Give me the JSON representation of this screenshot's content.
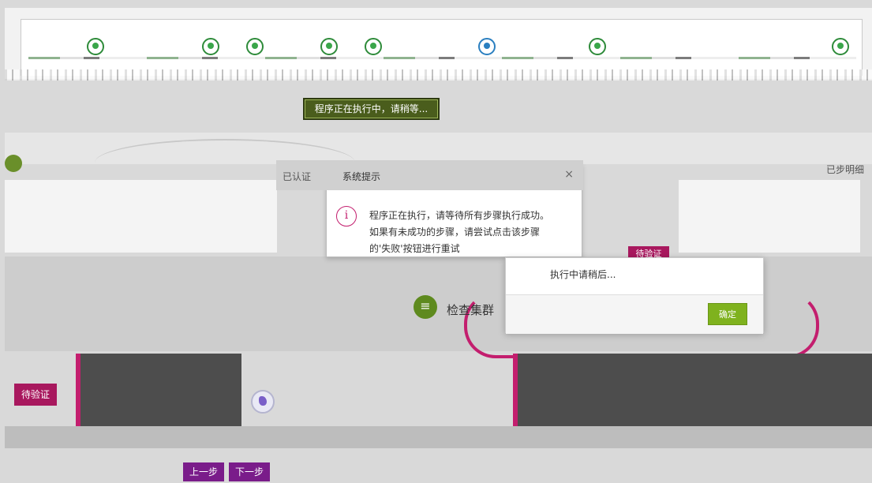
{
  "stepper": {
    "step_count": 8
  },
  "running_banner": "程序正在执行中，请稍等...",
  "header_right": {
    "tab_label": "已步明细"
  },
  "dialog": {
    "pretitle": "已认证",
    "title": "系统提示",
    "close": "×",
    "info_icon": "i",
    "message_lines": [
      "程序正在执行，请等待所有步骤执行成功。",
      "如果有未成功的步骤，请尝试点击该步骤",
      "的'失败'按钮进行重试"
    ]
  },
  "modal": {
    "body": "执行中请稍后...",
    "ok_label": "确定"
  },
  "to_verify_mid": "待验证",
  "check_label": "检查集群",
  "to_verify_left": "待验证",
  "nav": {
    "prev": "上一步",
    "next": "下一步"
  },
  "colors": {
    "accent_green": "#7fb21e",
    "accent_pink": "#a8185e",
    "nav_purple": "#7a1c8a"
  }
}
